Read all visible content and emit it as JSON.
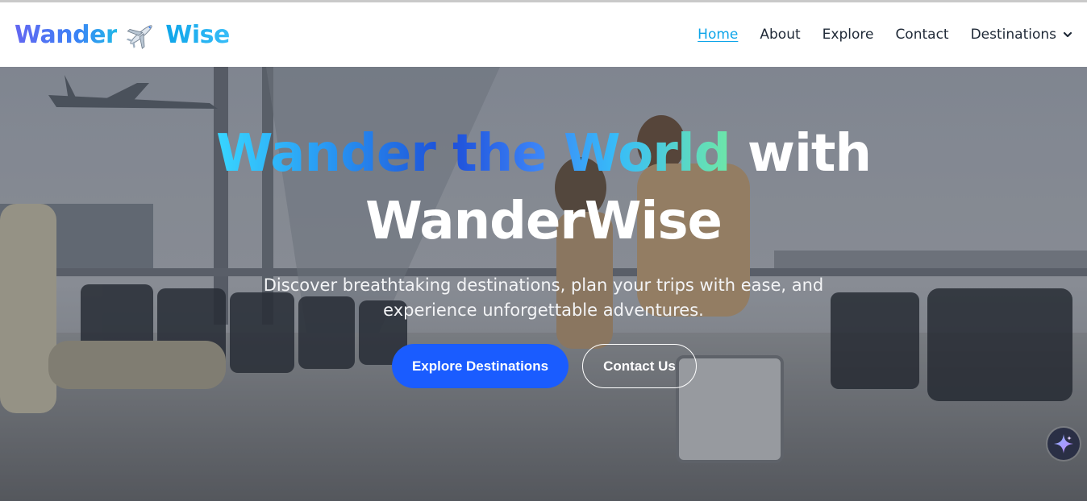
{
  "brand": {
    "word1": "Wander",
    "word2": "Wise",
    "icon": "airplane-icon"
  },
  "nav": {
    "items": [
      {
        "label": "Home",
        "active": true
      },
      {
        "label": "About"
      },
      {
        "label": "Explore"
      },
      {
        "label": "Contact"
      },
      {
        "label": "Destinations",
        "icon": "chevron-down-icon"
      }
    ]
  },
  "hero": {
    "headline_gradient": "Wander the World",
    "headline_rest": "with",
    "headline_line2": "WanderWise",
    "subtitle_line1": "Discover breathtaking destinations, plan your trips with ease, and",
    "subtitle_line2": "experience unforgettable adventures.",
    "primary_cta": "Explore Destinations",
    "secondary_cta": "Contact Us"
  },
  "floating": {
    "icon": "sparkle-icon"
  },
  "colors": {
    "accent": "#1a5cff",
    "active_link": "#0ea5e9"
  }
}
